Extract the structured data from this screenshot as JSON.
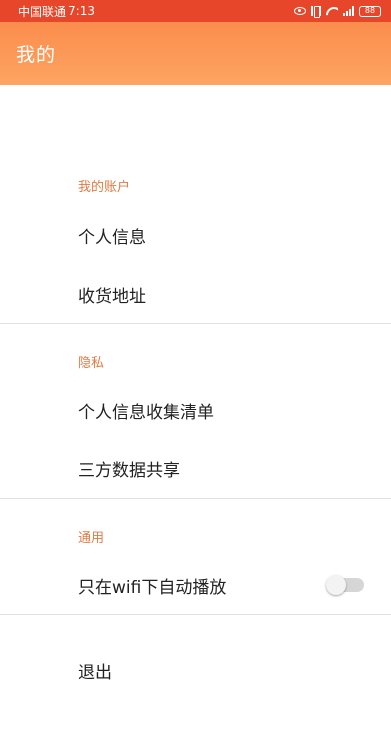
{
  "status_bar": {
    "carrier": "中国联通",
    "time": "7:13",
    "battery": "88",
    "background": "#e8462a"
  },
  "app_bar": {
    "title": "我的",
    "gradient": [
      "#fb8d4d",
      "#fda462"
    ]
  },
  "sections": {
    "account": {
      "header": "我的账户",
      "items": [
        "个人信息",
        "收货地址"
      ]
    },
    "privacy": {
      "header": "隐私",
      "items": [
        "个人信息收集清单",
        "三方数据共享"
      ]
    },
    "general": {
      "header": "通用",
      "items": [
        "只在wifi下自动播放"
      ],
      "autoplay_on_wifi_enabled": false
    }
  },
  "logout": "退出",
  "colors": {
    "accent": "#e07b45",
    "divider": "#e2e2e2"
  }
}
